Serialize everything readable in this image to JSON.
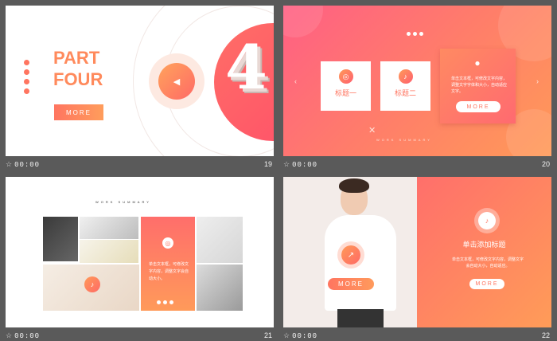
{
  "slides": {
    "s19": {
      "part_title_line1": "PART",
      "part_title_line2": "FOUR",
      "more_label": "MORE",
      "big_number": "4",
      "play_icon": "◀"
    },
    "s20": {
      "card1_label": "标题一",
      "card2_label": "标题二",
      "highlight_text": "单击文本框，可修改文字内容，调整文字字体和大小，自动适应文字。",
      "more_label": "MORE",
      "summary_text": "WORK SUMMARY",
      "left_arrow": "‹",
      "right_arrow": "›",
      "close_mark": "✕"
    },
    "s21": {
      "summary_text": "WORK SUMMARY",
      "column_text": "单击文本框，可修改文字内容，调整文字会自动大小。"
    },
    "s22": {
      "panel_title": "单击添加标题",
      "panel_text": "单击文本框，可修改文字内容，调整文字会自动大小，自动适应。",
      "panel_more": "MORE",
      "photo_more": "MORE"
    }
  },
  "footers": [
    {
      "star": "☆",
      "time": "00:00",
      "number": "19"
    },
    {
      "star": "☆",
      "time": "00:00",
      "number": "20"
    },
    {
      "star": "☆",
      "time": "00:00",
      "number": "21"
    },
    {
      "star": "☆",
      "time": "00:00",
      "number": "22"
    }
  ],
  "colors": {
    "accent_orange": "#ff8a5c",
    "accent_pink": "#ff5f84",
    "background": "#5a5a5a"
  }
}
